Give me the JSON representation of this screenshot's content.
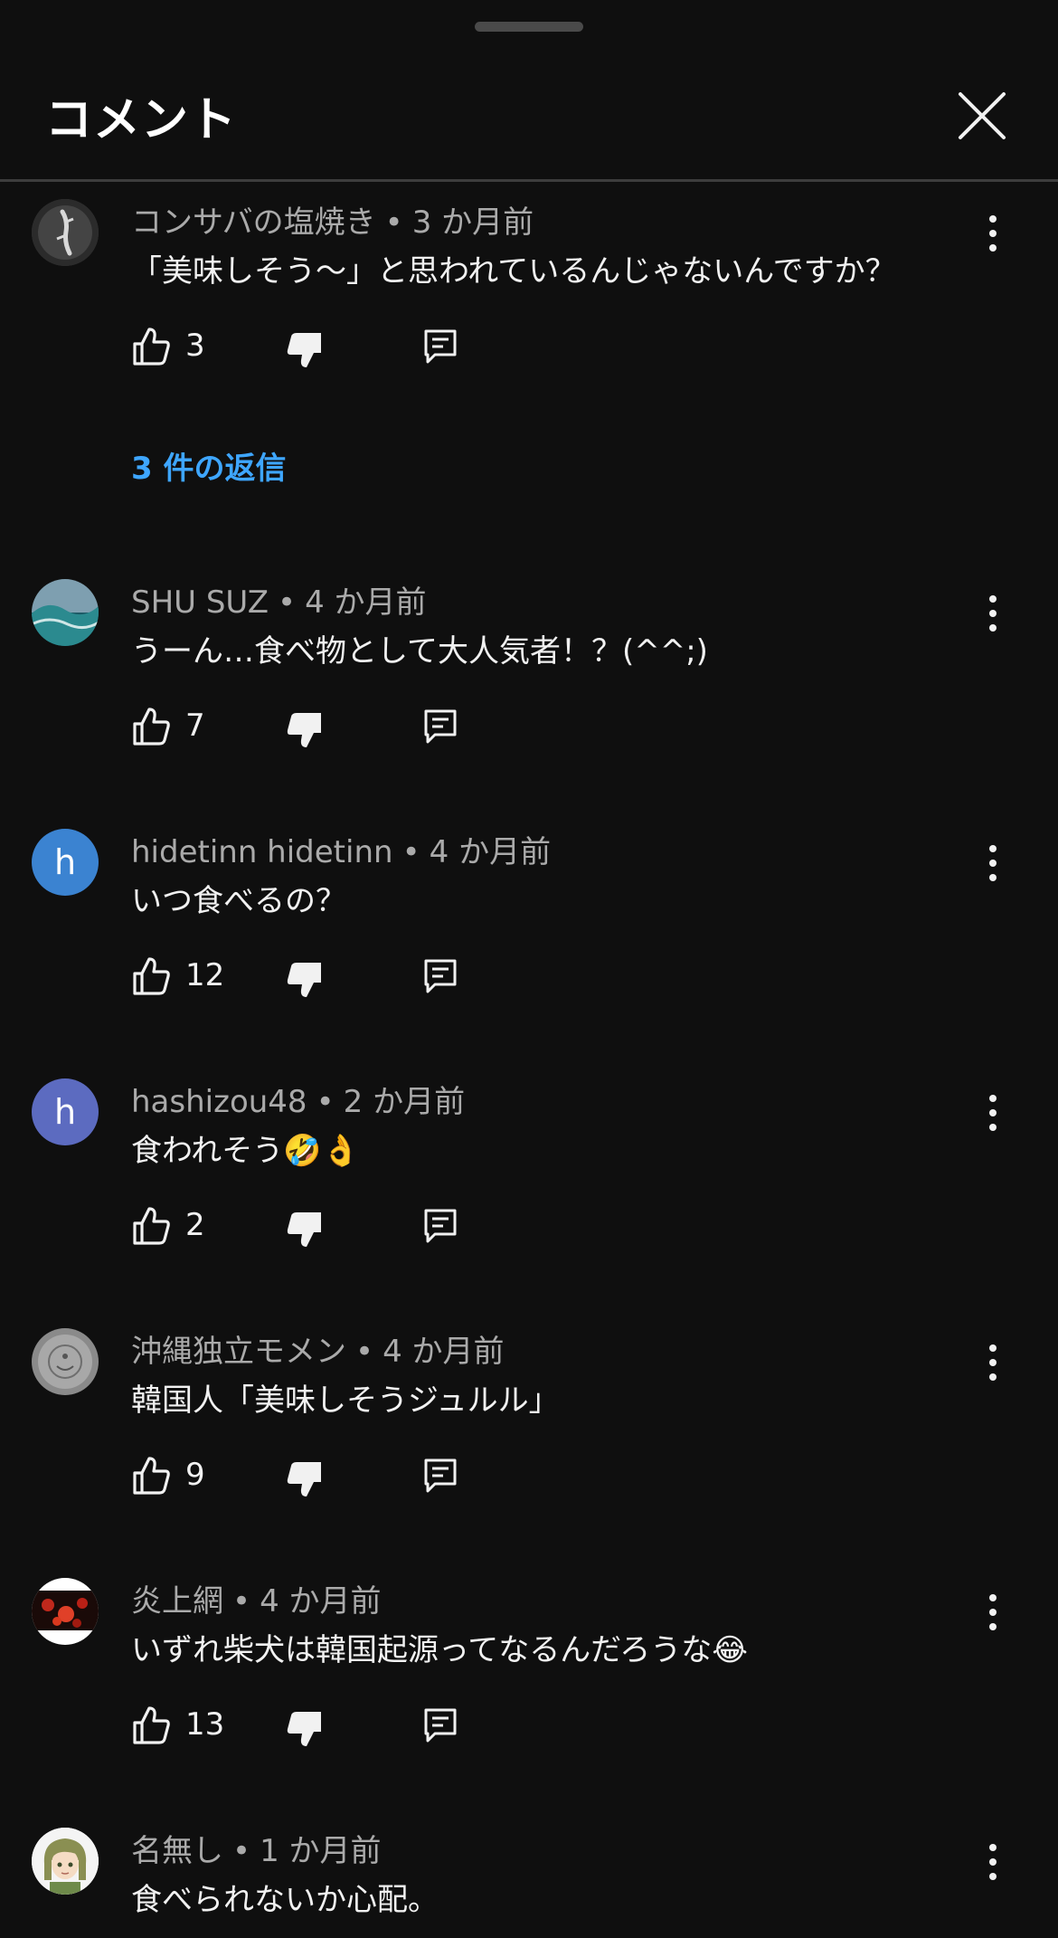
{
  "header": {
    "title": "コメント",
    "close_icon": "close-icon"
  },
  "colors": {
    "background": "#0f0f0f",
    "text_primary": "#f1f1f1",
    "text_secondary": "#aaaaaa",
    "link": "#3ea6ff",
    "divider": "#3d3d3d"
  },
  "comments": [
    {
      "author": "コンサバの塩焼き",
      "time": "3 か月前",
      "text": "「美味しそう〜」と思われているんじゃないんですか？",
      "likes": "3",
      "replies_label": "3 件の返信",
      "avatar": {
        "type": "image",
        "icon": "lizard-photo-avatar"
      }
    },
    {
      "author": "SHU SUZ",
      "time": "4 か月前",
      "text": "うーん…食べ物として大人気者！？(^^;)",
      "likes": "7",
      "avatar": {
        "type": "image",
        "icon": "ocean-wave-avatar"
      }
    },
    {
      "author": "hidetinn hidetinn",
      "time": "4 か月前",
      "text": "いつ食べるの？",
      "likes": "12",
      "avatar": {
        "type": "letter",
        "letter": "h",
        "color": "#3b83d1"
      }
    },
    {
      "author": "hashizou48",
      "time": "2 か月前",
      "text": "食われそう🤣👌",
      "likes": "2",
      "avatar": {
        "type": "letter",
        "letter": "h",
        "color": "#5c6bc0"
      }
    },
    {
      "author": "沖縄独立モメン",
      "time": "4 か月前",
      "text": "韓国人「美味しそうジュルル」",
      "likes": "9",
      "avatar": {
        "type": "image",
        "icon": "grey-stone-avatar"
      }
    },
    {
      "author": "炎上網",
      "time": "4 か月前",
      "text": "いずれ柴犬は韓国起源ってなるんだろうな😂",
      "likes": "13",
      "avatar": {
        "type": "image",
        "icon": "fire-avatar"
      }
    },
    {
      "author": "名無し",
      "time": "1 か月前",
      "text": "食べられないか心配。",
      "likes": "",
      "avatar": {
        "type": "image",
        "icon": "anime-girl-avatar"
      }
    }
  ],
  "icons": {
    "like": "thumbs-up-icon",
    "dislike": "thumbs-down-icon",
    "reply": "reply-comment-icon",
    "more": "more-vertical-icon"
  }
}
